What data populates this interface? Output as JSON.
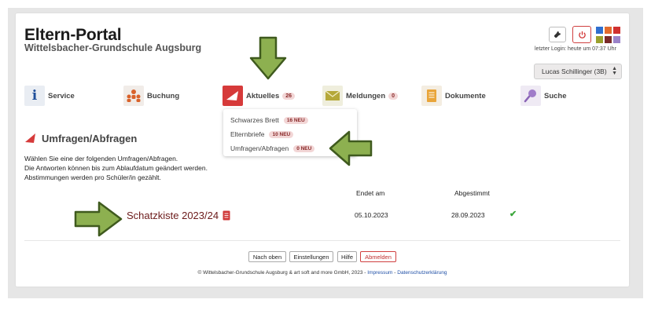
{
  "header": {
    "app_title": "Eltern-Portal",
    "school_name": "Wittelsbacher-Grundschule Augsburg",
    "last_login": "letzter Login: heute um 07:37 Uhr",
    "user_select_value": "Lucas Schillinger (3B)",
    "tile_colors": [
      "#2f6fcf",
      "#e26b2d",
      "#d0302f",
      "#9aa02c",
      "#7a2a2a",
      "#9a82c9"
    ]
  },
  "nav": {
    "items": [
      {
        "label": "Service",
        "icon": "info-icon"
      },
      {
        "label": "Buchung",
        "icon": "people-icon"
      },
      {
        "label": "Aktuelles",
        "badge": "26",
        "icon": "megaphone-icon"
      },
      {
        "label": "Meldungen",
        "badge": "0",
        "icon": "envelope-icon"
      },
      {
        "label": "Dokumente",
        "icon": "document-icon"
      },
      {
        "label": "Suche",
        "icon": "magnifier-icon"
      }
    ]
  },
  "dropdown": {
    "items": [
      {
        "label": "Schwarzes Brett",
        "badge": "16 NEU"
      },
      {
        "label": "Elternbriefe",
        "badge": "10 NEU"
      },
      {
        "label": "Umfragen/Abfragen",
        "badge": "0 NEU"
      }
    ]
  },
  "content": {
    "title": "Umfragen/Abfragen",
    "intro_lines": [
      "Wählen Sie eine der folgenden Umfragen/Abfragen.",
      "Die Antworten können bis zum Ablaufdatum geändert werden.",
      "Abstimmungen werden pro Schüler/in gezählt."
    ],
    "table": {
      "col_end": "Endet am",
      "col_voted": "Abgestimmt",
      "rows": [
        {
          "title": "Schatzkiste 2023/24",
          "end_date": "05.10.2023",
          "voted_date": "28.09.2023",
          "status": "check-icon"
        }
      ]
    }
  },
  "footer": {
    "buttons": {
      "top": "Nach oben",
      "settings": "Einstellungen",
      "help": "Hilfe",
      "logout": "Abmelden"
    },
    "copyright": "© Wittelsbacher-Grundschule Augsburg & art soft and more GmbH, 2023 -",
    "separator": "-",
    "impressum": "Impressum",
    "privacy": "Datenschutzerklärung"
  },
  "colors": {
    "accent_dark_red": "#6b1a1a",
    "badge_bg": "#f2d6d6",
    "arrow_green": "#8db050"
  }
}
